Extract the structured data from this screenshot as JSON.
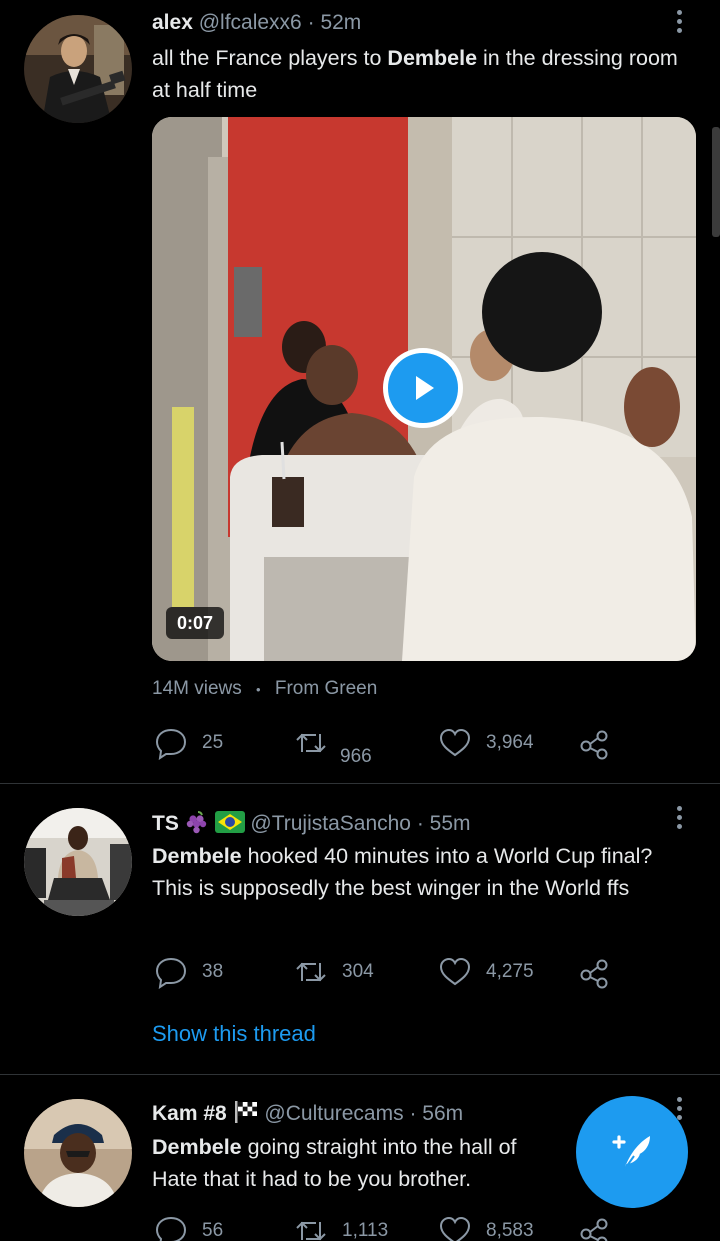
{
  "tweets": [
    {
      "name": "alex",
      "handle": "@lfcalexx6",
      "separator": "·",
      "time": "52m",
      "text_parts": [
        "all the France players to ",
        "Dembele",
        " in the dressing room at half time"
      ],
      "video": {
        "duration": "0:07"
      },
      "views": "14M views",
      "views_separator": "•",
      "source": "From Green",
      "replies": "25",
      "retweets": "966",
      "likes": "3,964"
    },
    {
      "name": "TS",
      "name_emojis": [
        "grapes-emoji",
        "brazil-flag-emoji"
      ],
      "handle": "@TrujistaSancho",
      "separator": "·",
      "time": "55m",
      "text_parts": [
        "Dembele",
        " hooked 40 minutes into a World Cup final? This is supposedly the best winger in the World ffs"
      ],
      "replies": "38",
      "retweets": "304",
      "likes": "4,275",
      "thread_link": "Show this thread"
    },
    {
      "name": "Kam #8",
      "name_emojis": [
        "checkered-flag-emoji"
      ],
      "handle": "@Culturecams",
      "separator": "·",
      "time": "56m",
      "text_parts": [
        "Dembele",
        " going straight into the hall of",
        "Hate that it had to be you brother."
      ],
      "replies": "56",
      "retweets": "1,113",
      "likes": "8,583"
    }
  ],
  "compose": {
    "icon": "compose-feather-icon"
  },
  "colors": {
    "accent": "#1d9bf0",
    "muted": "#8b98a5",
    "divider": "#2f3336",
    "background": "#000000"
  }
}
